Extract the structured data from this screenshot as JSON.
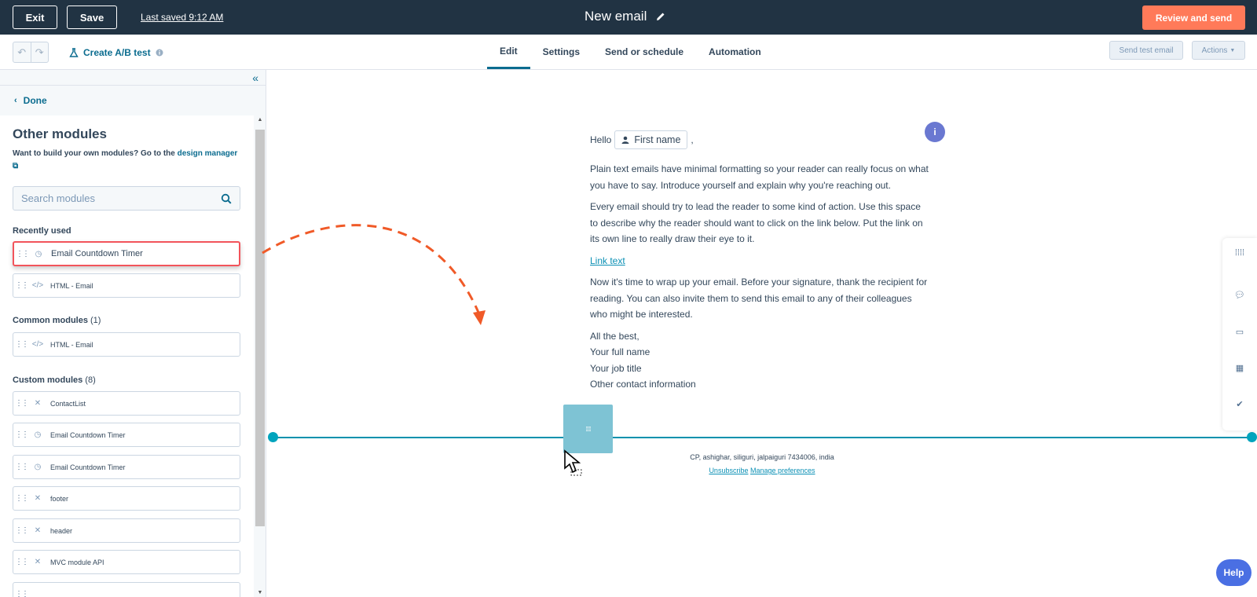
{
  "topbar": {
    "exit_label": "Exit",
    "save_label": "Save",
    "last_saved": "Last saved 9:12 AM",
    "title": "New email",
    "review_label": "Review and send"
  },
  "toolbar": {
    "ab_test_label": "Create A/B test",
    "tabs": [
      {
        "label": "Edit",
        "active": true
      },
      {
        "label": "Settings",
        "active": false
      },
      {
        "label": "Send or schedule",
        "active": false
      },
      {
        "label": "Automation",
        "active": false
      }
    ],
    "send_test_label": "Send test email",
    "actions_label": "Actions"
  },
  "sidebar": {
    "done_label": "Done",
    "heading": "Other modules",
    "hint_text": "Want to build your own modules? Go to the",
    "hint_link": "design manager",
    "search_placeholder": "Search modules",
    "recently_used_label": "Recently used",
    "recently_used": [
      {
        "label": "Email Countdown Timer",
        "icon": "clock-icon",
        "highlighted": true
      },
      {
        "label": "HTML - Email",
        "icon": "code-icon",
        "highlighted": false
      }
    ],
    "common_label": "Common modules",
    "common_count": "(1)",
    "common": [
      {
        "label": "HTML - Email",
        "icon": "code-icon"
      }
    ],
    "custom_label": "Custom modules",
    "custom_count": "(8)",
    "custom": [
      {
        "label": "ContactList",
        "icon": "x-icon"
      },
      {
        "label": "Email Countdown Timer",
        "icon": "clock-icon"
      },
      {
        "label": "Email Countdown Timer",
        "icon": "clock-icon"
      },
      {
        "label": "footer",
        "icon": "x-icon"
      },
      {
        "label": "header",
        "icon": "x-icon"
      },
      {
        "label": "MVC module API",
        "icon": "x-icon"
      }
    ]
  },
  "email": {
    "hello": "Hello",
    "token": "First name",
    "comma": ",",
    "p1": "Plain text emails have minimal formatting so your reader can really focus on what you have to say. Introduce yourself and explain why you're reaching out.",
    "p2": "Every email should try to lead the reader to some kind of action. Use this space to describe why the reader should want to click on the link below. Put the link on its own line to really draw their eye to it.",
    "link": "Link text",
    "p3": "Now it's time to wrap up your email. Before your signature, thank the recipient for reading. You can also invite them to send this email to any of their colleagues who might be interested.",
    "sign1": "All the best,",
    "sign2": "Your full name",
    "sign3": "Your job title",
    "sign4": "Other contact information"
  },
  "footer": {
    "address": "CP, ashighar, siliguri, jalpaiguri 7434006, india",
    "unsubscribe": "Unsubscribe",
    "manage": "Manage preferences"
  },
  "info_badge": "i",
  "help_label": "Help",
  "colors": {
    "topbar": "#213343",
    "accent": "#ff7a59",
    "link": "#0b6c8f",
    "drop_line": "#0091ae",
    "highlight": "#f2545b"
  }
}
